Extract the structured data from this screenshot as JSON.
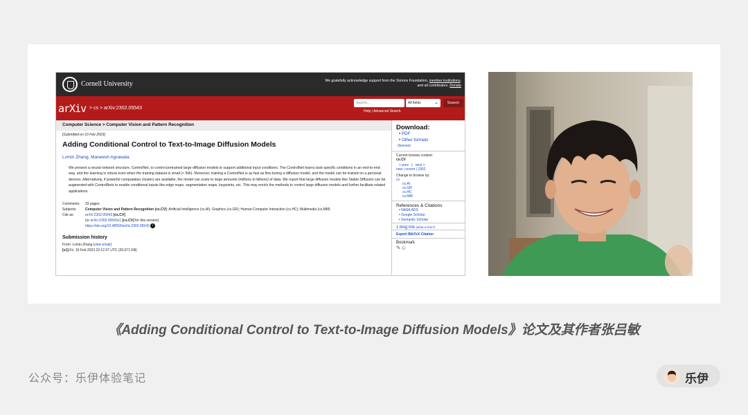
{
  "arxiv": {
    "institution": "Cornell University",
    "acknowledgment": {
      "text": "We gratefully acknowledge support from the Simons Foundation,",
      "link1": "member institutions",
      "middle": ", and all contributors.",
      "link2": "Donate"
    },
    "logo": "arXiv",
    "breadcrumb": "> cs > arXiv:2302.05543",
    "search": {
      "placeholder": "Search...",
      "field_select": "All fields",
      "button": "Search",
      "help": "Help | Advanced Search"
    },
    "subject_header": "Computer Science > Computer Vision and Pattern Recognition",
    "submitted": "[Submitted on 10 Feb 2023]",
    "title": "Adding Conditional Control to Text-to-Image Diffusion Models",
    "authors": "Lvmin Zhang, Maneesh Agrawala",
    "abstract": "We present a neural network structure, ControlNet, to control pretrained large diffusion models to support additional input conditions. The ControlNet learns task-specific conditions in an end-to-end way, and the learning is robust even when the training dataset is small (< 50k). Moreover, training a ControlNet is as fast as fine-tuning a diffusion model, and the model can be trained on a personal devices. Alternatively, if powerful computation clusters are available, the model can scale to large amounts (millions to billions) of data. We report that large diffusion models like Stable Diffusion can be augmented with ControlNets to enable conditional inputs like edge maps, segmentation maps, keypoints, etc. This may enrich the methods to control large diffusion models and further facilitate related applications.",
    "meta": {
      "comments_label": "Comments:",
      "comments": "33 pages",
      "subjects_label": "Subjects:",
      "subjects_bold": "Computer Vision and Pattern Recognition (cs.CV)",
      "subjects_rest": "; Artificial Intelligence (cs.AI); Graphics (cs.GR); Human-Computer Interaction (cs.HC); Multimedia (cs.MM)",
      "cite_label": "Cite as:",
      "cite_id": "arXiv:2302.05543",
      "cite_cat": "[cs.CV]",
      "cite_or": "(or",
      "cite_v1": "arXiv:2302.05543v1",
      "cite_v1_cat": "[cs.CV]",
      "cite_v1_rest": "for this version)",
      "doi": "https://doi.org/10.48550/arXiv.2302.05543"
    },
    "history": {
      "heading": "Submission history",
      "from": "From: Lvmin Zhang",
      "view_email": "[view email]",
      "v1_label": "[v1]",
      "v1": "Fri, 10 Feb 2023 23:12:37 UTC (20,671 KB)"
    },
    "sidebar": {
      "download_heading": "Download:",
      "pdf": "PDF",
      "other_formats": "Other formats",
      "license": "(license)",
      "browse_context_label": "Current browse context:",
      "browse_context": "cs.CV",
      "prev": "< prev",
      "sep": "|",
      "next": "next >",
      "new_recent": "new | recent | 2302",
      "change_browse": "Change to browse by:",
      "browse_cats": [
        "cs",
        "cs.AI",
        "cs.GR",
        "cs.HC",
        "cs.MM"
      ],
      "refs_heading": "References & Citations",
      "refs": [
        "NASA ADS",
        "Google Scholar",
        "Semantic Scholar"
      ],
      "blog": "1 blog link",
      "blog_what": "(what is this?)",
      "bibtex": "Export BibTeX Citation",
      "bookmark": "Bookmark"
    }
  },
  "caption": "《Adding Conditional Control to Text-to-Image Diffusion Models》论文及其作者张吕敏",
  "footer": {
    "account": "公众号：乐伊体验笔记",
    "badge_name": "乐伊"
  }
}
